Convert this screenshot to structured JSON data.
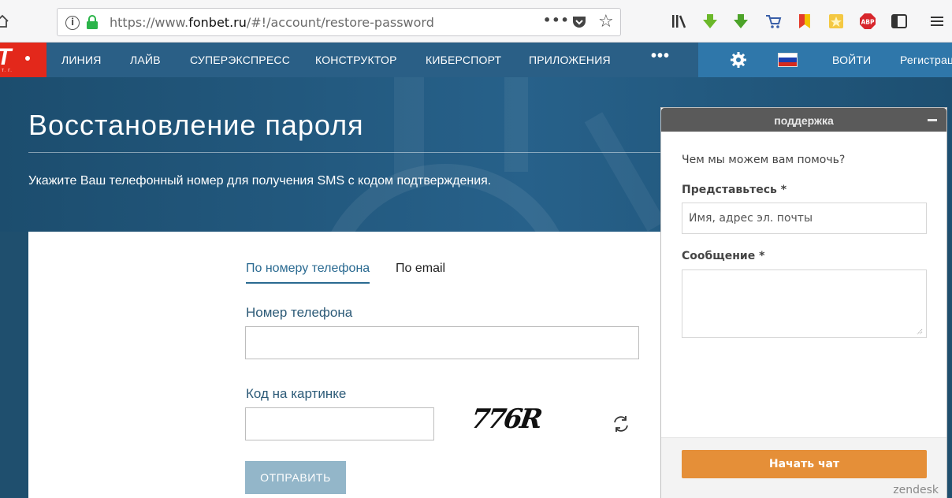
{
  "browser": {
    "url_prefix": "https://www.",
    "url_domain": "fonbet.ru",
    "url_path": "/#!/account/restore-password",
    "menu_dots": "•••",
    "icons": [
      "home-icon",
      "info-icon",
      "lock-icon",
      "page-actions-icon",
      "pocket-icon",
      "bookmark-star-icon",
      "library-icon",
      "download-icon",
      "download-alt-icon",
      "cart-icon",
      "bookmark-flag-icon",
      "extension-icon",
      "adblock-icon",
      "sidebar-icon",
      "menu-icon"
    ],
    "abp_label": "ABP"
  },
  "nav": {
    "logo_letter": "T",
    "logo_sub": "Т. Г.",
    "items": [
      "ЛИНИЯ",
      "ЛАЙВ",
      "СУПЕРЭКСПРЕСС",
      "КОНСТРУКТОР",
      "КИБЕРСПОРТ",
      "ПРИЛОЖЕНИЯ"
    ],
    "more": "•••",
    "login": "ВОЙТИ",
    "register": "Регистрац"
  },
  "hero": {
    "title": "Восстановление пароля",
    "description": "Укажите Ваш телефонный номер для получения SMS с кодом подтверждения."
  },
  "form": {
    "tabs": [
      {
        "label": "По номеру телефона",
        "active": true
      },
      {
        "label": "По email",
        "active": false
      }
    ],
    "phone_label": "Номер телефона",
    "phone_value": "",
    "captcha_label": "Код на картинке",
    "captcha_value": "",
    "captcha_text": "776R",
    "submit": "ОТПРАВИТЬ"
  },
  "support": {
    "title": "поддержка",
    "question": "Чем мы можем вам помочь?",
    "name_label": "Представьтесь *",
    "name_placeholder": "Имя, адрес эл. почты",
    "message_label": "Сообщение *",
    "message_value": "",
    "chat_button": "Начать чат",
    "brand": "zendesk"
  },
  "colors": {
    "nav_bg": "#2a5f86",
    "nav_right_bg": "#2f77aa",
    "logo_red": "#e3281b",
    "accent": "#2a6a91",
    "submit_disabled": "#93b6c9",
    "chat_orange": "#e58f38"
  }
}
